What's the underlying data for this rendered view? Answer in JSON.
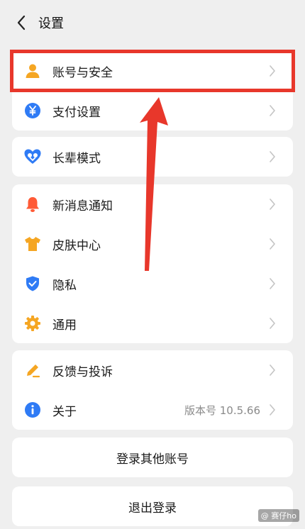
{
  "header": {
    "title": "设置"
  },
  "cards": [
    {
      "items": [
        {
          "label": "账号与安全",
          "icon": "user-icon"
        },
        {
          "label": "支付设置",
          "icon": "yuan-icon"
        }
      ]
    },
    {
      "items": [
        {
          "label": "长辈模式",
          "icon": "heart-elder-icon"
        }
      ]
    },
    {
      "items": [
        {
          "label": "新消息通知",
          "icon": "bell-icon"
        },
        {
          "label": "皮肤中心",
          "icon": "tshirt-icon"
        },
        {
          "label": "隐私",
          "icon": "shield-check-icon"
        },
        {
          "label": "通用",
          "icon": "gear-icon"
        }
      ]
    },
    {
      "items": [
        {
          "label": "反馈与投诉",
          "icon": "pencil-icon"
        },
        {
          "label": "关于",
          "icon": "info-icon",
          "value": "版本号 10.5.66"
        }
      ]
    }
  ],
  "buttons": {
    "switch_account": "登录其他账号",
    "logout": "退出登录"
  },
  "watermark": "@ 赛仔ho",
  "colors": {
    "highlight": "#e8372b",
    "user": "#f5a623",
    "yuan": "#2f7bf5",
    "bell": "#ff5a36"
  }
}
